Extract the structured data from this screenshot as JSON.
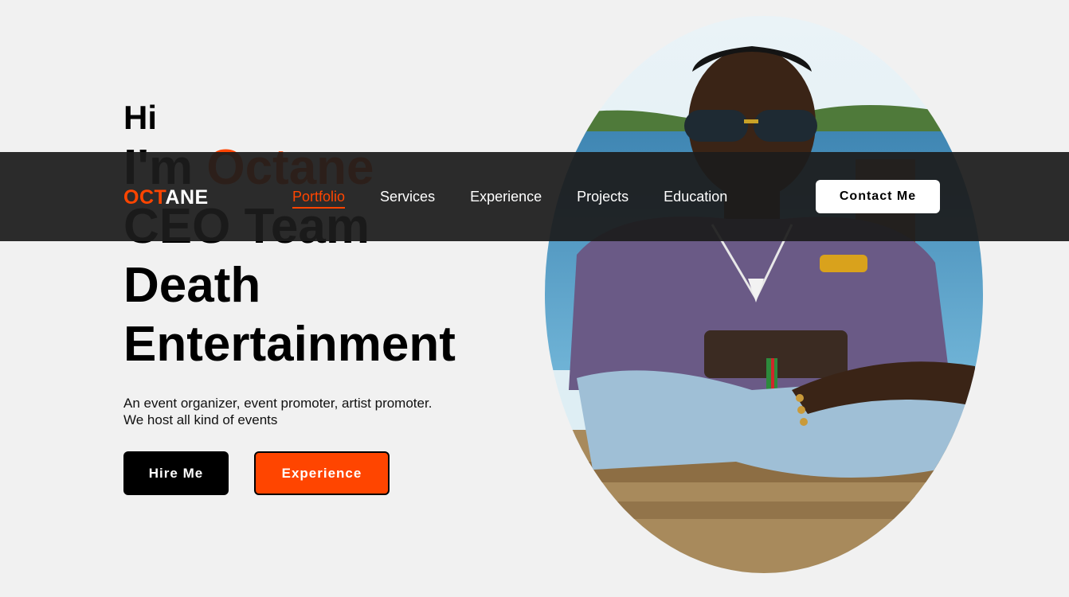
{
  "hero": {
    "greeting": "Hi",
    "intro_prefix": "I'm",
    "name": "Octane",
    "title_line_1": "CEO Team",
    "title_line_2": "Death",
    "title_line_3": "Entertainment",
    "description_line_1": "An event organizer, event promoter, artist promoter.",
    "description_line_2": "We host all kind of events",
    "hire_button": "Hire Me",
    "experience_button": "Experience"
  },
  "nav": {
    "logo_accent": "OCT",
    "logo_rest": "ANE",
    "items": [
      {
        "label": "Portfolio",
        "active": true
      },
      {
        "label": "Services",
        "active": false
      },
      {
        "label": "Experience",
        "active": false
      },
      {
        "label": "Projects",
        "active": false
      },
      {
        "label": "Education",
        "active": false
      }
    ],
    "contact_button": "Contact Me"
  },
  "portrait": {
    "icon": "profile-photo"
  },
  "colors": {
    "accent": "#ff4500",
    "background": "#f1f1f1",
    "navbar": "#1c1c1c",
    "text": "#000000"
  }
}
